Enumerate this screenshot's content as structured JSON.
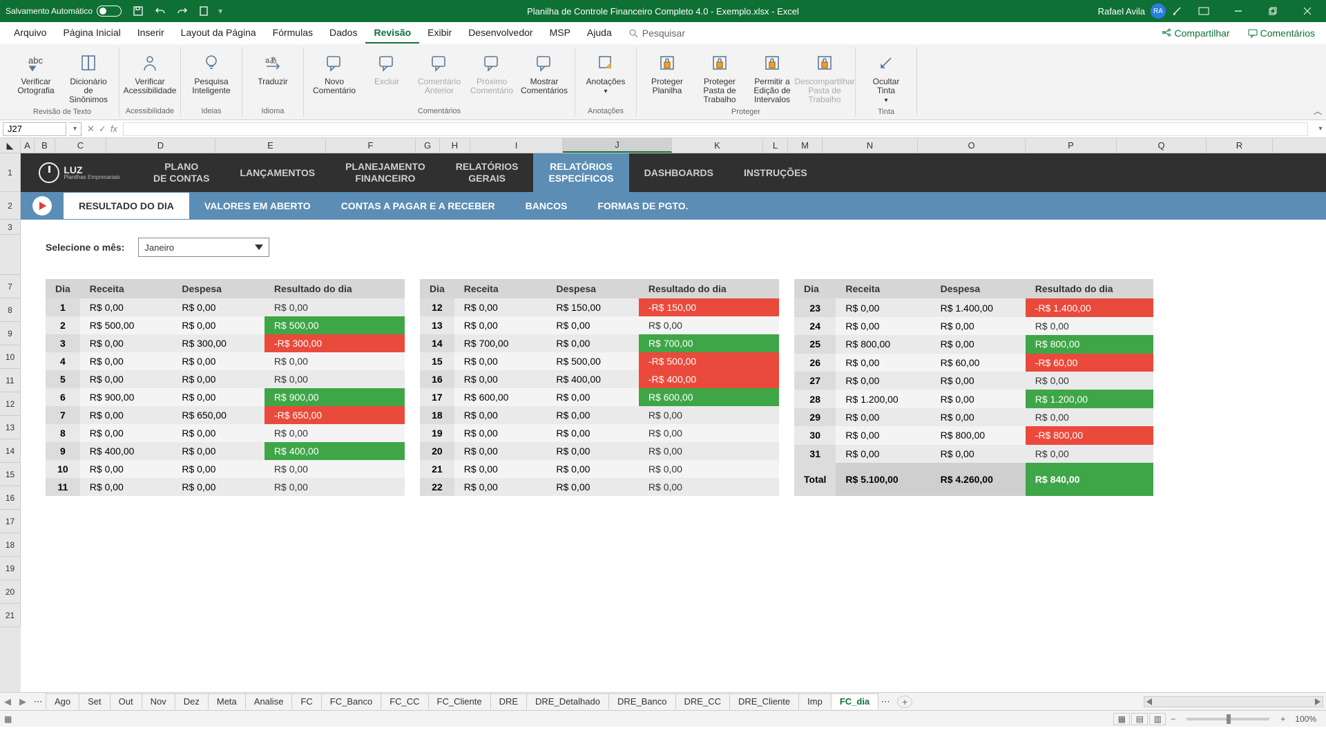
{
  "titlebar": {
    "autosave": "Salvamento Automático",
    "doc": "Planilha de Controle Financeiro Completo 4.0 - Exemplo.xlsx  -  Excel",
    "user": "Rafael Avila",
    "initials": "RA"
  },
  "menu": {
    "items": [
      "Arquivo",
      "Página Inicial",
      "Inserir",
      "Layout da Página",
      "Fórmulas",
      "Dados",
      "Revisão",
      "Exibir",
      "Desenvolvedor",
      "MSP",
      "Ajuda"
    ],
    "activeIndex": 6,
    "search": "Pesquisar",
    "share": "Compartilhar",
    "comments": "Comentários"
  },
  "ribbon": {
    "groups": [
      {
        "label": "Revisão de Texto",
        "buttons": [
          {
            "l": "Verificar Ortografia",
            "glyph": "abc"
          },
          {
            "l": "Dicionário de Sinônimos",
            "glyph": "book"
          }
        ]
      },
      {
        "label": "Acessibilidade",
        "buttons": [
          {
            "l": "Verificar Acessibilidade",
            "glyph": "person"
          }
        ]
      },
      {
        "label": "Ideias",
        "buttons": [
          {
            "l": "Pesquisa Inteligente",
            "glyph": "bulb"
          }
        ]
      },
      {
        "label": "Idioma",
        "buttons": [
          {
            "l": "Traduzir",
            "glyph": "lang"
          }
        ]
      },
      {
        "label": "Comentários",
        "buttons": [
          {
            "l": "Novo Comentário",
            "glyph": "note"
          },
          {
            "l": "Excluir",
            "glyph": "note",
            "disabled": true
          },
          {
            "l": "Comentário Anterior",
            "glyph": "note",
            "disabled": true
          },
          {
            "l": "Próximo Comentário",
            "glyph": "note",
            "disabled": true
          },
          {
            "l": "Mostrar Comentários",
            "glyph": "note"
          }
        ]
      },
      {
        "label": "Anotações",
        "buttons": [
          {
            "l": "Anotações",
            "glyph": "sticky",
            "drop": true
          }
        ]
      },
      {
        "label": "Proteger",
        "buttons": [
          {
            "l": "Proteger Planilha",
            "glyph": "lock"
          },
          {
            "l": "Proteger Pasta de Trabalho",
            "glyph": "lock"
          },
          {
            "l": "Permitir a Edição de Intervalos",
            "glyph": "lock"
          },
          {
            "l": "Descompartilhar Pasta de Trabalho",
            "glyph": "lock",
            "disabled": true
          }
        ]
      },
      {
        "label": "Tinta",
        "buttons": [
          {
            "l": "Ocultar Tinta",
            "glyph": "pen",
            "drop": true
          }
        ]
      }
    ]
  },
  "namebox": "J27",
  "fx": "fx",
  "columns": [
    "A",
    "B",
    "C",
    "D",
    "E",
    "F",
    "G",
    "H",
    "I",
    "J",
    "K",
    "L",
    "M",
    "N",
    "O",
    "P",
    "Q",
    "R"
  ],
  "rows": [
    "1",
    "2",
    "3",
    "",
    "7",
    "8",
    "9",
    "10",
    "11",
    "12",
    "13",
    "14",
    "15",
    "16",
    "17",
    "18",
    "19",
    "20",
    "21"
  ],
  "topnav": {
    "logo": "LUZ",
    "logo_sub": "Planilhas Empresariais",
    "items": [
      "PLANO DE CONTAS",
      "LANÇAMENTOS",
      "PLANEJAMENTO FINANCEIRO",
      "RELATÓRIOS GERAIS",
      "RELATÓRIOS ESPECÍFICOS",
      "DASHBOARDS",
      "INSTRUÇÕES"
    ],
    "activeIndex": 4
  },
  "subnav": {
    "items": [
      "RESULTADO DO DIA",
      "VALORES EM ABERTO",
      "CONTAS A PAGAR E A RECEBER",
      "BANCOS",
      "FORMAS DE PGTO."
    ],
    "activeIndex": 0
  },
  "filter": {
    "label": "Selecione o mês:",
    "value": "Janeiro"
  },
  "headers": [
    "Dia",
    "Receita",
    "Despesa",
    "Resultado do dia"
  ],
  "t1": [
    {
      "d": "1",
      "r": "R$ 0,00",
      "e": "R$ 0,00",
      "x": "R$ 0,00",
      "c": ""
    },
    {
      "d": "2",
      "r": "R$ 500,00",
      "e": "R$ 0,00",
      "x": "R$ 500,00",
      "c": "pos"
    },
    {
      "d": "3",
      "r": "R$ 0,00",
      "e": "R$ 300,00",
      "x": "-R$ 300,00",
      "c": "neg"
    },
    {
      "d": "4",
      "r": "R$ 0,00",
      "e": "R$ 0,00",
      "x": "R$ 0,00",
      "c": ""
    },
    {
      "d": "5",
      "r": "R$ 0,00",
      "e": "R$ 0,00",
      "x": "R$ 0,00",
      "c": ""
    },
    {
      "d": "6",
      "r": "R$ 900,00",
      "e": "R$ 0,00",
      "x": "R$ 900,00",
      "c": "pos"
    },
    {
      "d": "7",
      "r": "R$ 0,00",
      "e": "R$ 650,00",
      "x": "-R$ 650,00",
      "c": "neg"
    },
    {
      "d": "8",
      "r": "R$ 0,00",
      "e": "R$ 0,00",
      "x": "R$ 0,00",
      "c": ""
    },
    {
      "d": "9",
      "r": "R$ 400,00",
      "e": "R$ 0,00",
      "x": "R$ 400,00",
      "c": "pos"
    },
    {
      "d": "10",
      "r": "R$ 0,00",
      "e": "R$ 0,00",
      "x": "R$ 0,00",
      "c": ""
    },
    {
      "d": "11",
      "r": "R$ 0,00",
      "e": "R$ 0,00",
      "x": "R$ 0,00",
      "c": ""
    }
  ],
  "t2": [
    {
      "d": "12",
      "r": "R$ 0,00",
      "e": "R$ 150,00",
      "x": "-R$ 150,00",
      "c": "neg"
    },
    {
      "d": "13",
      "r": "R$ 0,00",
      "e": "R$ 0,00",
      "x": "R$ 0,00",
      "c": ""
    },
    {
      "d": "14",
      "r": "R$ 700,00",
      "e": "R$ 0,00",
      "x": "R$ 700,00",
      "c": "pos"
    },
    {
      "d": "15",
      "r": "R$ 0,00",
      "e": "R$ 500,00",
      "x": "-R$ 500,00",
      "c": "neg"
    },
    {
      "d": "16",
      "r": "R$ 0,00",
      "e": "R$ 400,00",
      "x": "-R$ 400,00",
      "c": "neg"
    },
    {
      "d": "17",
      "r": "R$ 600,00",
      "e": "R$ 0,00",
      "x": "R$ 600,00",
      "c": "pos"
    },
    {
      "d": "18",
      "r": "R$ 0,00",
      "e": "R$ 0,00",
      "x": "R$ 0,00",
      "c": ""
    },
    {
      "d": "19",
      "r": "R$ 0,00",
      "e": "R$ 0,00",
      "x": "R$ 0,00",
      "c": ""
    },
    {
      "d": "20",
      "r": "R$ 0,00",
      "e": "R$ 0,00",
      "x": "R$ 0,00",
      "c": ""
    },
    {
      "d": "21",
      "r": "R$ 0,00",
      "e": "R$ 0,00",
      "x": "R$ 0,00",
      "c": ""
    },
    {
      "d": "22",
      "r": "R$ 0,00",
      "e": "R$ 0,00",
      "x": "R$ 0,00",
      "c": ""
    }
  ],
  "t3": [
    {
      "d": "23",
      "r": "R$ 0,00",
      "e": "R$ 1.400,00",
      "x": "-R$ 1.400,00",
      "c": "neg"
    },
    {
      "d": "24",
      "r": "R$ 0,00",
      "e": "R$ 0,00",
      "x": "R$ 0,00",
      "c": ""
    },
    {
      "d": "25",
      "r": "R$ 800,00",
      "e": "R$ 0,00",
      "x": "R$ 800,00",
      "c": "pos"
    },
    {
      "d": "26",
      "r": "R$ 0,00",
      "e": "R$ 60,00",
      "x": "-R$ 60,00",
      "c": "neg"
    },
    {
      "d": "27",
      "r": "R$ 0,00",
      "e": "R$ 0,00",
      "x": "R$ 0,00",
      "c": ""
    },
    {
      "d": "28",
      "r": "R$ 1.200,00",
      "e": "R$ 0,00",
      "x": "R$ 1.200,00",
      "c": "pos"
    },
    {
      "d": "29",
      "r": "R$ 0,00",
      "e": "R$ 0,00",
      "x": "R$ 0,00",
      "c": ""
    },
    {
      "d": "30",
      "r": "R$ 0,00",
      "e": "R$ 800,00",
      "x": "-R$ 800,00",
      "c": "neg"
    },
    {
      "d": "31",
      "r": "R$ 0,00",
      "e": "R$ 0,00",
      "x": "R$ 0,00",
      "c": ""
    }
  ],
  "total": {
    "label": "Total",
    "r": "R$ 5.100,00",
    "e": "R$ 4.260,00",
    "x": "R$ 840,00",
    "c": "pos"
  },
  "sheets": [
    "Ago",
    "Set",
    "Out",
    "Nov",
    "Dez",
    "Meta",
    "Analise",
    "FC",
    "FC_Banco",
    "FC_CC",
    "FC_Cliente",
    "DRE",
    "DRE_Detalhado",
    "DRE_Banco",
    "DRE_CC",
    "DRE_Cliente",
    "Imp",
    "FC_dia"
  ],
  "activeSheetIndex": 17,
  "zoom": "100%"
}
